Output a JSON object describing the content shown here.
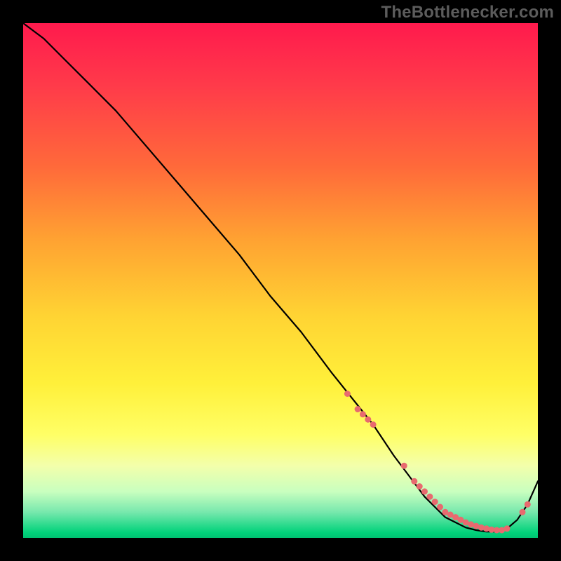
{
  "watermark": "TheBottlenecker.com",
  "chart_data": {
    "type": "line",
    "title": "",
    "xlabel": "",
    "ylabel": "",
    "xlim": [
      0,
      100
    ],
    "ylim": [
      0,
      100
    ],
    "grid": false,
    "series": [
      {
        "name": "bottleneck-curve",
        "x": [
          0,
          4,
          8,
          12,
          18,
          24,
          30,
          36,
          42,
          48,
          54,
          60,
          64,
          68,
          72,
          75,
          78,
          80,
          82,
          84,
          86,
          88,
          90,
          92,
          94,
          96,
          98,
          100
        ],
        "y": [
          100,
          97,
          93,
          89,
          83,
          76,
          69,
          62,
          55,
          47,
          40,
          32,
          27,
          22,
          16,
          12,
          8,
          6,
          4,
          3,
          2,
          1.5,
          1.2,
          1.2,
          1.8,
          3.5,
          6.5,
          11
        ]
      }
    ],
    "markers": {
      "name": "highlight-dots",
      "x": [
        63,
        65,
        66,
        67,
        68,
        74,
        76,
        77,
        78,
        79,
        80,
        81,
        82,
        83,
        84,
        85,
        86,
        87,
        88,
        89,
        90,
        91,
        92,
        93,
        94,
        97,
        98
      ],
      "y": [
        28,
        25,
        24,
        23,
        22,
        14,
        11,
        10,
        9,
        8,
        7,
        6,
        5,
        4.5,
        4,
        3.5,
        3,
        2.6,
        2.3,
        2,
        1.8,
        1.6,
        1.5,
        1.5,
        1.8,
        5,
        6.5
      ]
    }
  },
  "colors": {
    "background": "#000000",
    "curve": "#000000",
    "dots": "#e86a6f",
    "gradient_top": "#ff1a4d",
    "gradient_bottom": "#00c272"
  }
}
